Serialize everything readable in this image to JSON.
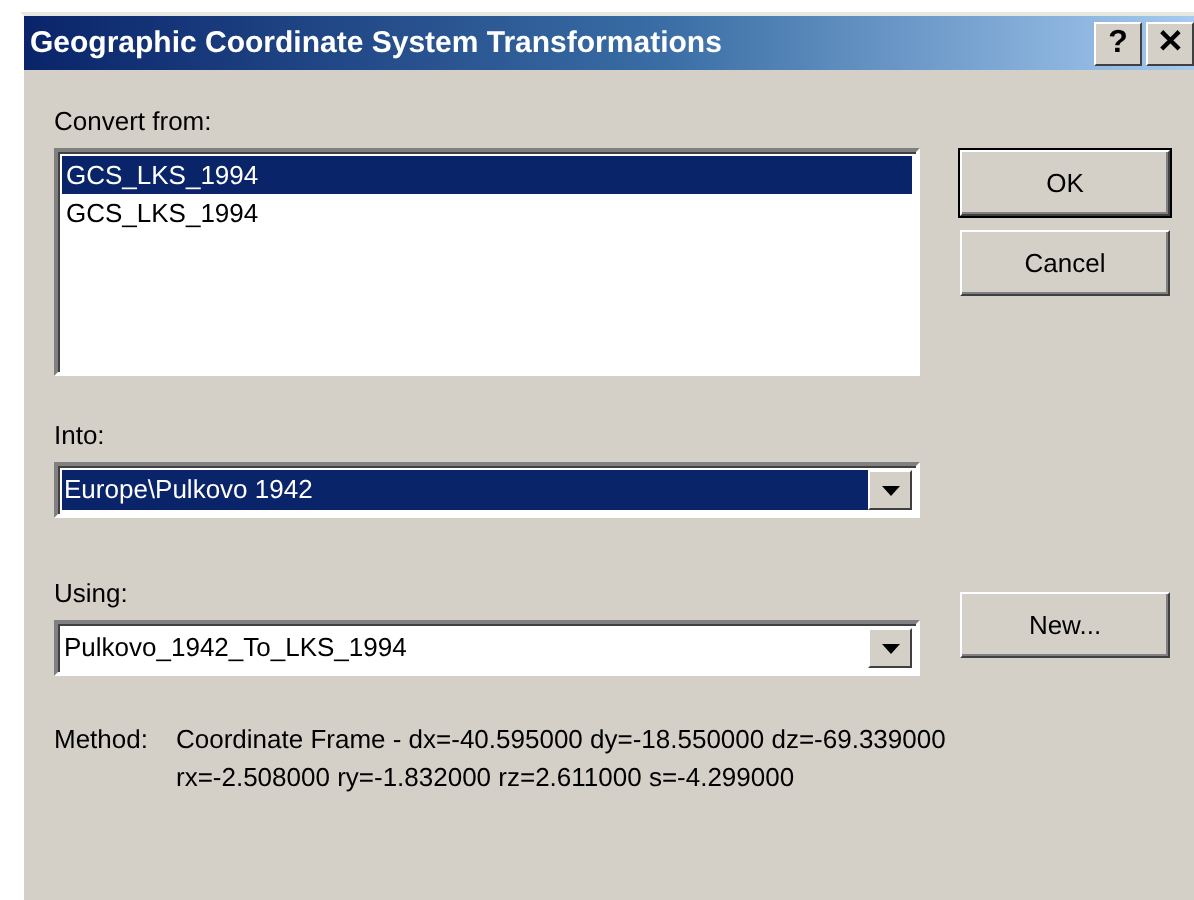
{
  "window": {
    "title": "Geographic Coordinate System Transformations",
    "title_buttons": [
      "?",
      "✕"
    ]
  },
  "convert_from": {
    "label": "Convert from:",
    "items": [
      {
        "text": "GCS_LKS_1994",
        "selected": true
      },
      {
        "text": "GCS_LKS_1994",
        "selected": false
      }
    ]
  },
  "into": {
    "label": "Into:",
    "value": "Europe\\Pulkovo 1942",
    "selected": true
  },
  "using": {
    "label": "Using:",
    "value": "Pulkovo_1942_To_LKS_1994",
    "selected": false
  },
  "buttons": [
    "OK",
    "Cancel"
  ],
  "new_button": "New...",
  "method": {
    "label": "Method:",
    "text": "Coordinate Frame - dx=-40.595000 dy=-18.550000 dz=-69.339000 rx=-2.508000 ry=-1.832000 rz=2.611000 s=-4.299000"
  }
}
